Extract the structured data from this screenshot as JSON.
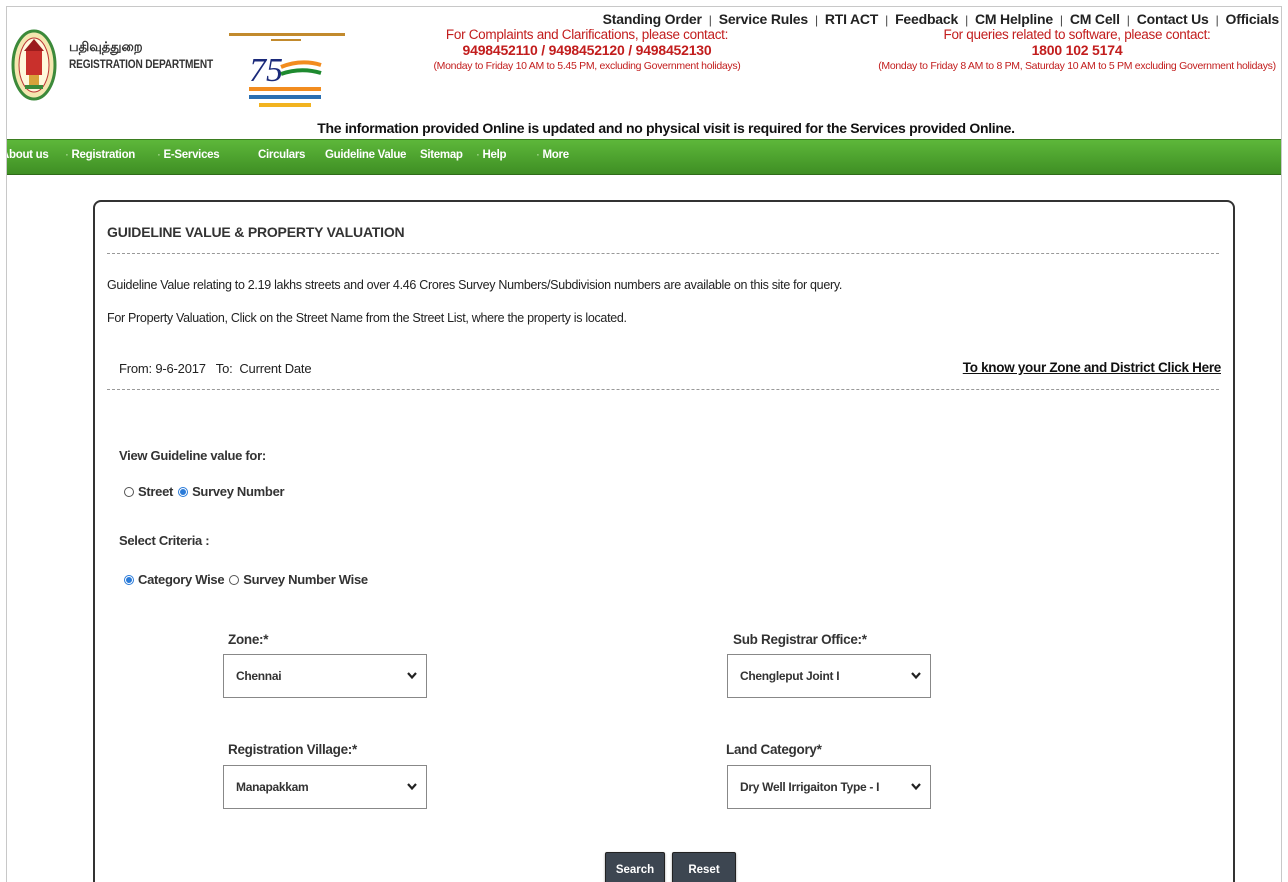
{
  "top_links": [
    "Standing Order",
    "Service Rules",
    "RTI ACT",
    "Feedback",
    "CM Helpline",
    "CM Cell",
    "Contact Us",
    "Officials"
  ],
  "header": {
    "dept_tamil": "பதிவுத்துறை",
    "dept_english": "REGISTRATION DEPARTMENT",
    "complaints": {
      "heading": "For Complaints and Clarifications, please contact:",
      "phones": "9498452110 / 9498452120 / 9498452130",
      "hours": "(Monday to Friday 10 AM to 5.45 PM, excluding Government holidays)"
    },
    "software": {
      "heading": "For queries related to software, please contact:",
      "phone": "1800 102 5174",
      "hours": "(Monday to Friday 8 AM to 8 PM, Saturday 10 AM to 5 PM excluding Government holidays)"
    },
    "info_line": "The information provided Online is updated and no physical visit is required for the Services provided Online."
  },
  "nav": {
    "items": [
      "About us",
      "Registration",
      "E-Services",
      "Circulars",
      "Guideline Value",
      "Sitemap",
      "Help",
      "More"
    ]
  },
  "panel": {
    "title": "GUIDELINE VALUE & PROPERTY VALUATION",
    "para1": "Guideline Value relating to 2.19 lakhs streets and over 4.46 Crores Survey Numbers/Subdivision numbers are available on this site for query.",
    "para2": "For Property Valuation, Click on the Street Name from the Street List, where the property is located.",
    "from_to": "From: 9-6-2017   To:  Current Date",
    "zone_link": "To know your Zone and District Click Here",
    "view_label": "View Guideline value for:",
    "view_options": [
      "Street",
      "Survey Number"
    ],
    "view_selected": "Survey Number",
    "criteria_label": "Select Criteria :",
    "criteria_options": [
      "Category Wise",
      "Survey Number Wise"
    ],
    "criteria_selected": "Category Wise",
    "fields": {
      "zone": {
        "label": "Zone:*",
        "value": "Chennai"
      },
      "sro": {
        "label": "Sub Registrar Office:*",
        "value": "Chengleput Joint I"
      },
      "village": {
        "label": "Registration Village:*",
        "value": "Manapakkam"
      },
      "land": {
        "label": "Land Category*",
        "value": "Dry Well Irrigaiton Type - I"
      }
    },
    "search_label": "Search",
    "reset_label": "Reset"
  },
  "colors": {
    "nav_green": "#4aa22c",
    "contact_red": "#c21d1d",
    "button_dark": "#3d4651",
    "radio_blue": "#2a7bd9"
  },
  "icons": {
    "emblem": "tamil-nadu-emblem",
    "azadi": "azadi-ka-amrit-mahotsav-logo",
    "select_arrow": "chevron-down-icon"
  }
}
